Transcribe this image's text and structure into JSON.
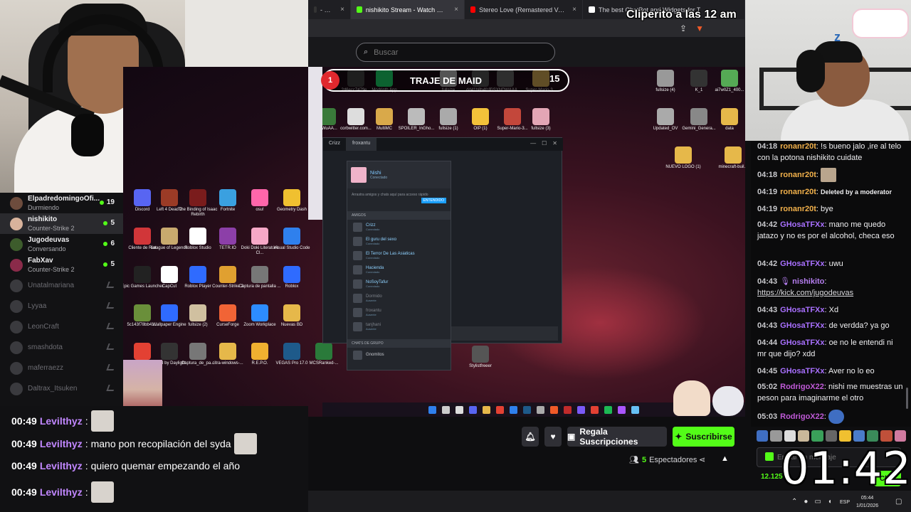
{
  "browser": {
    "tabs": [
      {
        "label": "- Watch L",
        "active": false,
        "icon_color": "#333333"
      },
      {
        "label": "nishikito Stream - Watch Live on",
        "active": true,
        "icon_color": "#53fc18"
      },
      {
        "label": "Stereo Love (Remastered Version) - Y",
        "active": false,
        "icon_color": "#ff0000"
      },
      {
        "label": "The best ChatBot and Widgets for T",
        "active": false,
        "icon_color": "#ffffff"
      }
    ],
    "close_glyph": "×"
  },
  "overlay_title": "Cliperito a las 12 am",
  "search": {
    "placeholder": "Buscar",
    "icon": "search-icon"
  },
  "stream": {
    "banner_text": "TRAJE DE MAID",
    "banner_left_num": "1",
    "banner_right_num": "15",
    "desktop_icons": [
      {
        "label": "2d6ecc7479e...",
        "color": "#444444"
      },
      {
        "label": "Modrinth App",
        "color": "#1bd96a"
      },
      {
        "label": "fullsize",
        "color": "#bbbbbb"
      },
      {
        "label": "dd41b8b4fc0...",
        "color": "#555555"
      },
      {
        "label": "GSXNDWAAA...",
        "color": "#666666"
      },
      {
        "label": "Super-Mario-3...",
        "color": "#d4aa55"
      },
      {
        "label": "fullsize (4)",
        "color": "#999999"
      },
      {
        "label": "K_1",
        "color": "#333333"
      },
      {
        "label": "ai7w0Z1_400...",
        "color": "#55aa55"
      },
      {
        "label": "IPWuAA...",
        "color": "#3a7a3a"
      },
      {
        "label": "corbwitter.com...",
        "color": "#dddddd"
      },
      {
        "label": "MultiMC",
        "color": "#d9a94a"
      },
      {
        "label": "SPOILER_InGho...",
        "color": "#bbbbbb"
      },
      {
        "label": "fullsize (1)",
        "color": "#aaaaaa"
      },
      {
        "label": "OIP (1)",
        "color": "#f3c23a"
      },
      {
        "label": "Super-Mario-3...",
        "color": "#c3473b"
      },
      {
        "label": "fullsize (3)",
        "color": "#e3a6b5"
      },
      {
        "label": "Updated_OV",
        "color": "#aaaaaa"
      },
      {
        "label": "Gemini_Genera...",
        "color": "#888888"
      },
      {
        "label": "data",
        "color": "#e6b84a"
      },
      {
        "label": "NUEVO LOGO (1)",
        "color": "#e6b84a"
      },
      {
        "label": "minecraft-buil...",
        "color": "#e6b84a"
      },
      {
        "label": "Discord",
        "color": "#5865f2"
      },
      {
        "label": "Left 4 Dead 2",
        "color": "#9b3b26"
      },
      {
        "label": "The Binding of Isaac Rebirth",
        "color": "#7a1c1c"
      },
      {
        "label": "Fortnite",
        "color": "#3aa0e0"
      },
      {
        "label": "osu!",
        "color": "#ff66aa"
      },
      {
        "label": "Geometry Dash",
        "color": "#f0c030"
      },
      {
        "label": "Cliente de Riot",
        "color": "#d13639"
      },
      {
        "label": "League of Legends",
        "color": "#c8aa6e"
      },
      {
        "label": "Roblox Studio",
        "color": "#ffffff"
      },
      {
        "label": "TETR.IO",
        "color": "#8c3fa8"
      },
      {
        "label": "Doki Doki Literature Cl...",
        "color": "#f7a8c7"
      },
      {
        "label": "Visual Studio Code",
        "color": "#2f80ed"
      },
      {
        "label": "Epic Games Launcher",
        "color": "#222222"
      },
      {
        "label": "CapCut",
        "color": "#ffffff"
      },
      {
        "label": "Roblox Player",
        "color": "#2f6bff"
      },
      {
        "label": "Counter-Strike 2",
        "color": "#e0a030"
      },
      {
        "label": "Captura de pantalla ...",
        "color": "#777777"
      },
      {
        "label": "Roblox",
        "color": "#2f6bff"
      },
      {
        "label": "5c143f78bb41...",
        "color": "#6a8f3a"
      },
      {
        "label": "Wallpaper Engine",
        "color": "#2f6bff"
      },
      {
        "label": "fullsize (2)",
        "color": "#d0c0a0"
      },
      {
        "label": "CurseForge",
        "color": "#f16436"
      },
      {
        "label": "Zoom Workplace",
        "color": "#2d8cff"
      },
      {
        "label": "Nuevas BD",
        "color": "#e6b84a"
      },
      {
        "label": "Google Chrome",
        "color": "#e34133"
      },
      {
        "label": "Dead by Daylight",
        "color": "#333333"
      },
      {
        "label": "Captura_de_pa...",
        "color": "#777777"
      },
      {
        "label": "citra-windows-...",
        "color": "#e6b84a"
      },
      {
        "label": "R.E.P.O.",
        "color": "#f0b030"
      },
      {
        "label": "VEGAS Pro 17.0",
        "color": "#1e5a8a"
      },
      {
        "label": "MCSRanked-...",
        "color": "#2a7a3a"
      },
      {
        "label": "Stylistfreeer",
        "color": "#555555"
      }
    ],
    "steam_tabs": [
      "Crizz",
      "froxantu"
    ],
    "steam_ctrl": [
      "—",
      "☐",
      "✕"
    ],
    "friends": {
      "name": "Nishi",
      "status": "Conectado",
      "note": "Arrastra amigos y chats aquí para acceso rápido",
      "note_btn": "ENTENDIDO",
      "section": "AMIGOS",
      "list": [
        {
          "name": "Crizz",
          "status": "Conectado",
          "online": true
        },
        {
          "name": "El guru del sexo",
          "status": "Conectado",
          "online": true
        },
        {
          "name": "El Terror De Las Asiaticas",
          "status": "Conectado",
          "online": true
        },
        {
          "name": "Hacienda",
          "status": "Conectado",
          "online": true
        },
        {
          "name": "NoSoyTafur",
          "status": "Conectado",
          "online": true
        },
        {
          "name": "Dormido",
          "status": "Ausente",
          "online": false
        },
        {
          "name": "froxantu",
          "status": "Ausente",
          "online": false
        },
        {
          "name": "tanjhani",
          "status": "Ausente",
          "online": false
        }
      ],
      "group_section": "CHATS DE GRUPO",
      "group": "Gnomitos"
    }
  },
  "sidebar": {
    "channels": [
      {
        "name": "ElpadredomingoOfi...",
        "game": "Durmiendo",
        "count": "19",
        "online": true,
        "selected": false,
        "avatar_color": "#6d4c3d"
      },
      {
        "name": "nishikito",
        "game": "Counter-Strike 2",
        "count": "5",
        "online": true,
        "selected": true,
        "avatar_color": "#d9b39c"
      },
      {
        "name": "Jugodeuvas",
        "game": "Conversando",
        "count": "6",
        "online": true,
        "selected": false,
        "avatar_color": "#3d5c2c"
      },
      {
        "name": "FabXav",
        "game": "Counter-Strike 2",
        "count": "5",
        "online": true,
        "selected": false,
        "avatar_color": "#8a2b4a"
      },
      {
        "name": "Unatalmariana",
        "game": "",
        "count": "",
        "online": false,
        "selected": false,
        "avatar_color": "#3a3a3e"
      },
      {
        "name": "Lyyaa",
        "game": "",
        "count": "",
        "online": false,
        "selected": false,
        "avatar_color": "#3a3a3e"
      },
      {
        "name": "LeonCraft",
        "game": "",
        "count": "",
        "online": false,
        "selected": false,
        "avatar_color": "#3a3a3e"
      },
      {
        "name": "smashdota",
        "game": "",
        "count": "",
        "online": false,
        "selected": false,
        "avatar_color": "#3a3a3e"
      },
      {
        "name": "maferraezz",
        "game": "",
        "count": "",
        "online": false,
        "selected": false,
        "avatar_color": "#3a3a3e"
      },
      {
        "name": "Daltrax_Itsuken",
        "game": "",
        "count": "",
        "online": false,
        "selected": false,
        "avatar_color": "#3a3a3e"
      }
    ]
  },
  "overlay_chat": [
    {
      "time": "00:49",
      "user": "Levilthyz",
      "text": "",
      "emote": true
    },
    {
      "time": "00:49",
      "user": "Levilthyz",
      "text": "mano pon recopilación del syda",
      "emote": true
    },
    {
      "time": "00:49",
      "user": "Levilthyz",
      "text": "quiero quemar empezando el año",
      "emote": false
    },
    {
      "time": "00:49",
      "user": "Levilthyz",
      "text": "",
      "emote": true
    }
  ],
  "actions": {
    "gift_label": "Regala Suscripciones",
    "subscribe_label": "Suscribirse",
    "viewers_count": "5",
    "viewers_label": "Espectadores"
  },
  "chat": {
    "messages": [
      {
        "time": "04:18",
        "user": "ronanr20t",
        "color": "#f2b14b",
        "text": "!s bueno jalo ,ire al telo con la potona nishikito cuidate",
        "emote": false
      },
      {
        "time": "04:18",
        "user": "ronanr20t",
        "color": "#f2b14b",
        "text": "",
        "emote": true
      },
      {
        "time": "04:19",
        "user": "ronanr20t",
        "color": "#f2b14b",
        "text": "Deleted by a moderator",
        "emote": false,
        "mod": true
      },
      {
        "time": "04:19",
        "user": "ronanr20t",
        "color": "#f2b14b",
        "text": "bye",
        "emote": false
      },
      {
        "time": "04:42",
        "user": "GHosaTFXx",
        "color": "#a970ff",
        "text": "mano me quedo jatazo y no es por el alcohol, checa eso",
        "emote": false
      },
      {
        "time": "04:42",
        "user": "GHosaTFXx",
        "color": "#a970ff",
        "text": "uwu",
        "emote": false
      },
      {
        "time": "04:43",
        "user": "nishikito",
        "color": "#b57ef0",
        "text": "https://kick.com/jugodeuvas",
        "emote": false,
        "link": true,
        "badge": true
      },
      {
        "time": "04:43",
        "user": "GHosaTFXx",
        "color": "#a970ff",
        "text": "Xd",
        "emote": false
      },
      {
        "time": "04:43",
        "user": "GHosaTFXx",
        "color": "#a970ff",
        "text": "de verdda? ya go",
        "emote": false
      },
      {
        "time": "04:44",
        "user": "GHosaTFXx",
        "color": "#a970ff",
        "text": "oe no le entendi ni mr que dijo? xdd",
        "emote": false
      },
      {
        "time": "04:45",
        "user": "GHosaTFXx",
        "color": "#a970ff",
        "text": "Aver no lo eo",
        "emote": false
      },
      {
        "time": "05:02",
        "user": "RodrigoX22",
        "color": "#c05ad8",
        "text": "nishi me muestras un peson para imaginarme el otro",
        "emote": false
      },
      {
        "time": "05:03",
        "user": "RodrigoX22",
        "color": "#c05ad8",
        "text": "",
        "emote": true,
        "emote_blue": true
      }
    ],
    "input_placeholder": "Enviar un mensaje",
    "points": "12.125",
    "send_label": "Chat",
    "timer": "01:42"
  },
  "system": {
    "lang": "ESP",
    "time": "05:44",
    "date": "1/01/2026"
  },
  "colors": {
    "kick_green": "#53fc18",
    "bg": "#0e0e10"
  }
}
